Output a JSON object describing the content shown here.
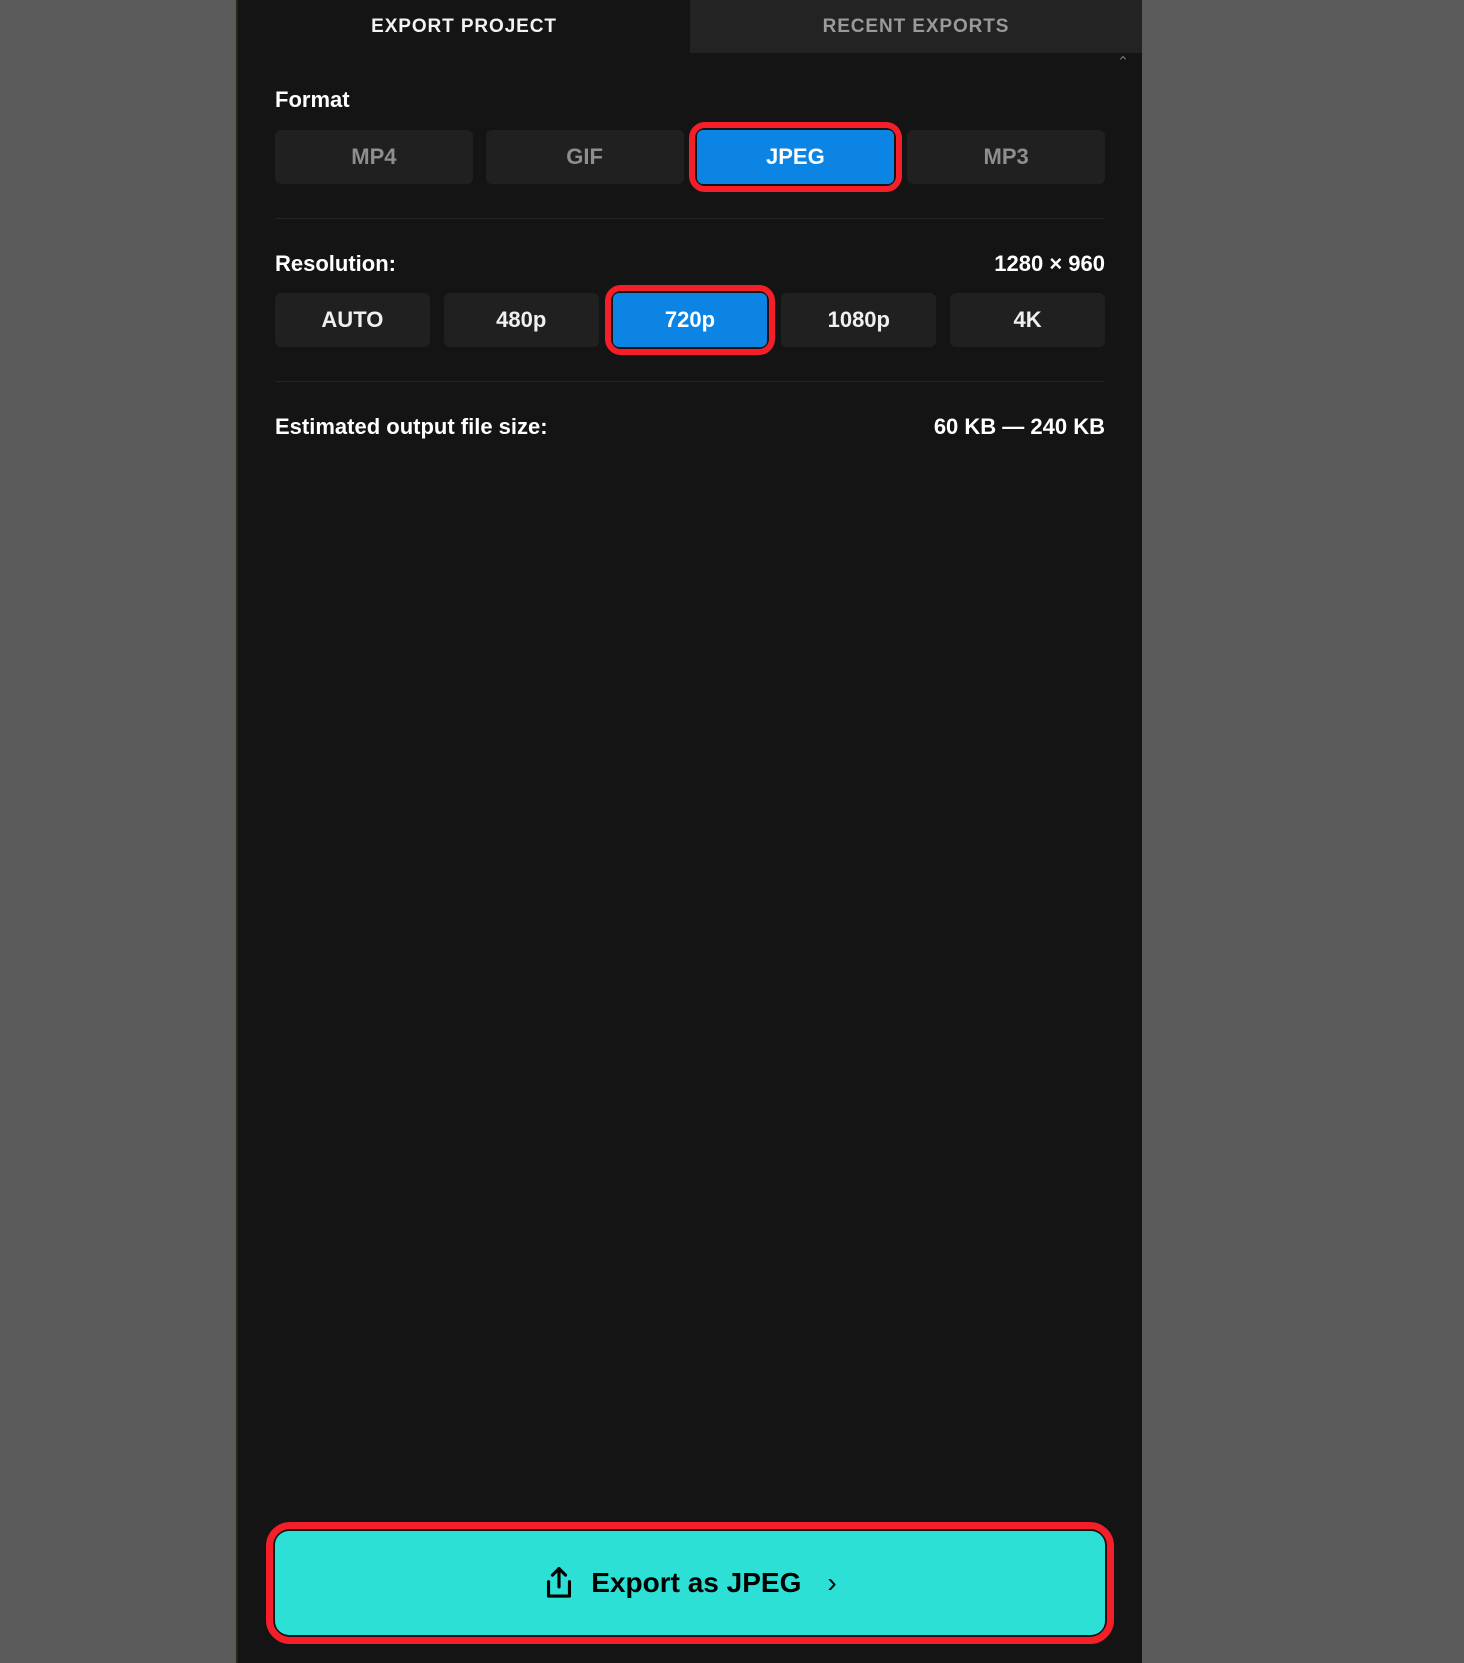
{
  "window": {
    "outer_background": "#5a5a5a",
    "panel_background": "#141414"
  },
  "tabs": [
    {
      "label": "EXPORT PROJECT",
      "state": "active"
    },
    {
      "label": "RECENT EXPORTS",
      "state": "inactive"
    }
  ],
  "scroll": {
    "chevron_icon": "chevron-up-icon",
    "glyph": "⌃"
  },
  "format": {
    "title": "Format",
    "options": [
      {
        "label": "MP4",
        "selected": false,
        "enabled": false,
        "highlighted": false
      },
      {
        "label": "GIF",
        "selected": false,
        "enabled": false,
        "highlighted": false
      },
      {
        "label": "JPEG",
        "selected": true,
        "enabled": true,
        "highlighted": true
      },
      {
        "label": "MP3",
        "selected": false,
        "enabled": false,
        "highlighted": false
      }
    ]
  },
  "resolution": {
    "label": "Resolution:",
    "value": "1280 × 960",
    "options": [
      {
        "label": "AUTO",
        "selected": false,
        "enabled": true,
        "highlighted": false
      },
      {
        "label": "480p",
        "selected": false,
        "enabled": true,
        "highlighted": false
      },
      {
        "label": "720p",
        "selected": true,
        "enabled": true,
        "highlighted": true
      },
      {
        "label": "1080p",
        "selected": false,
        "enabled": true,
        "highlighted": false
      },
      {
        "label": "4K",
        "selected": false,
        "enabled": true,
        "highlighted": false
      }
    ]
  },
  "filesize": {
    "label": "Estimated output file size:",
    "value": "60 KB — 240 KB"
  },
  "cta": {
    "label": "Export as JPEG",
    "icon": "share-upload-icon",
    "chevron": "›",
    "background": "#2ce0d6",
    "highlighted": true
  },
  "colors": {
    "accent_selected": "#0c84e4",
    "annotation_ring": "#f41f28",
    "cta": "#2ce0d6"
  }
}
